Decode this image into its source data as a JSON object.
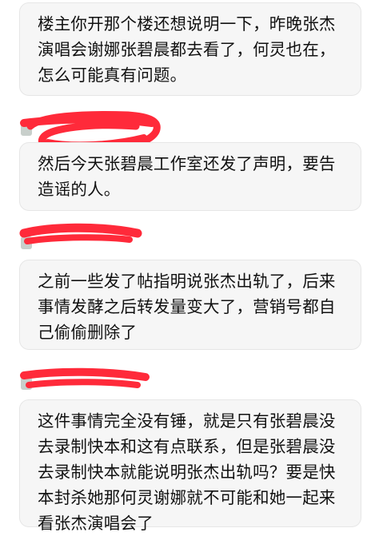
{
  "messages": [
    {
      "text": "楼主你开那个楼还想说明一下，昨晚张杰\n演唱会谢娜张碧晨都去看了，何灵也在，\n怎么可能真有问题。"
    },
    {
      "text": "然后今天张碧晨工作室还发了声明，要告\n造谣的人。"
    },
    {
      "text": "之前一些发了帖指明说张杰出轨了，后来\n事情发酵之后转发量变大了，营销号都自\n己偷偷删除了"
    },
    {
      "text": "这件事情完全没有锤，就是只有张碧晨没\n去录制快本和这有点联系，但是张碧晨没\n去录制快本就能说明张杰出轨吗？要是快\n本封杀她那何灵谢娜就不可能和她一起来\n看张杰演唱会了"
    }
  ],
  "colors": {
    "redaction": "#ff2a3a",
    "bubble_bg": "#f6f6f6",
    "text": "#111111"
  }
}
